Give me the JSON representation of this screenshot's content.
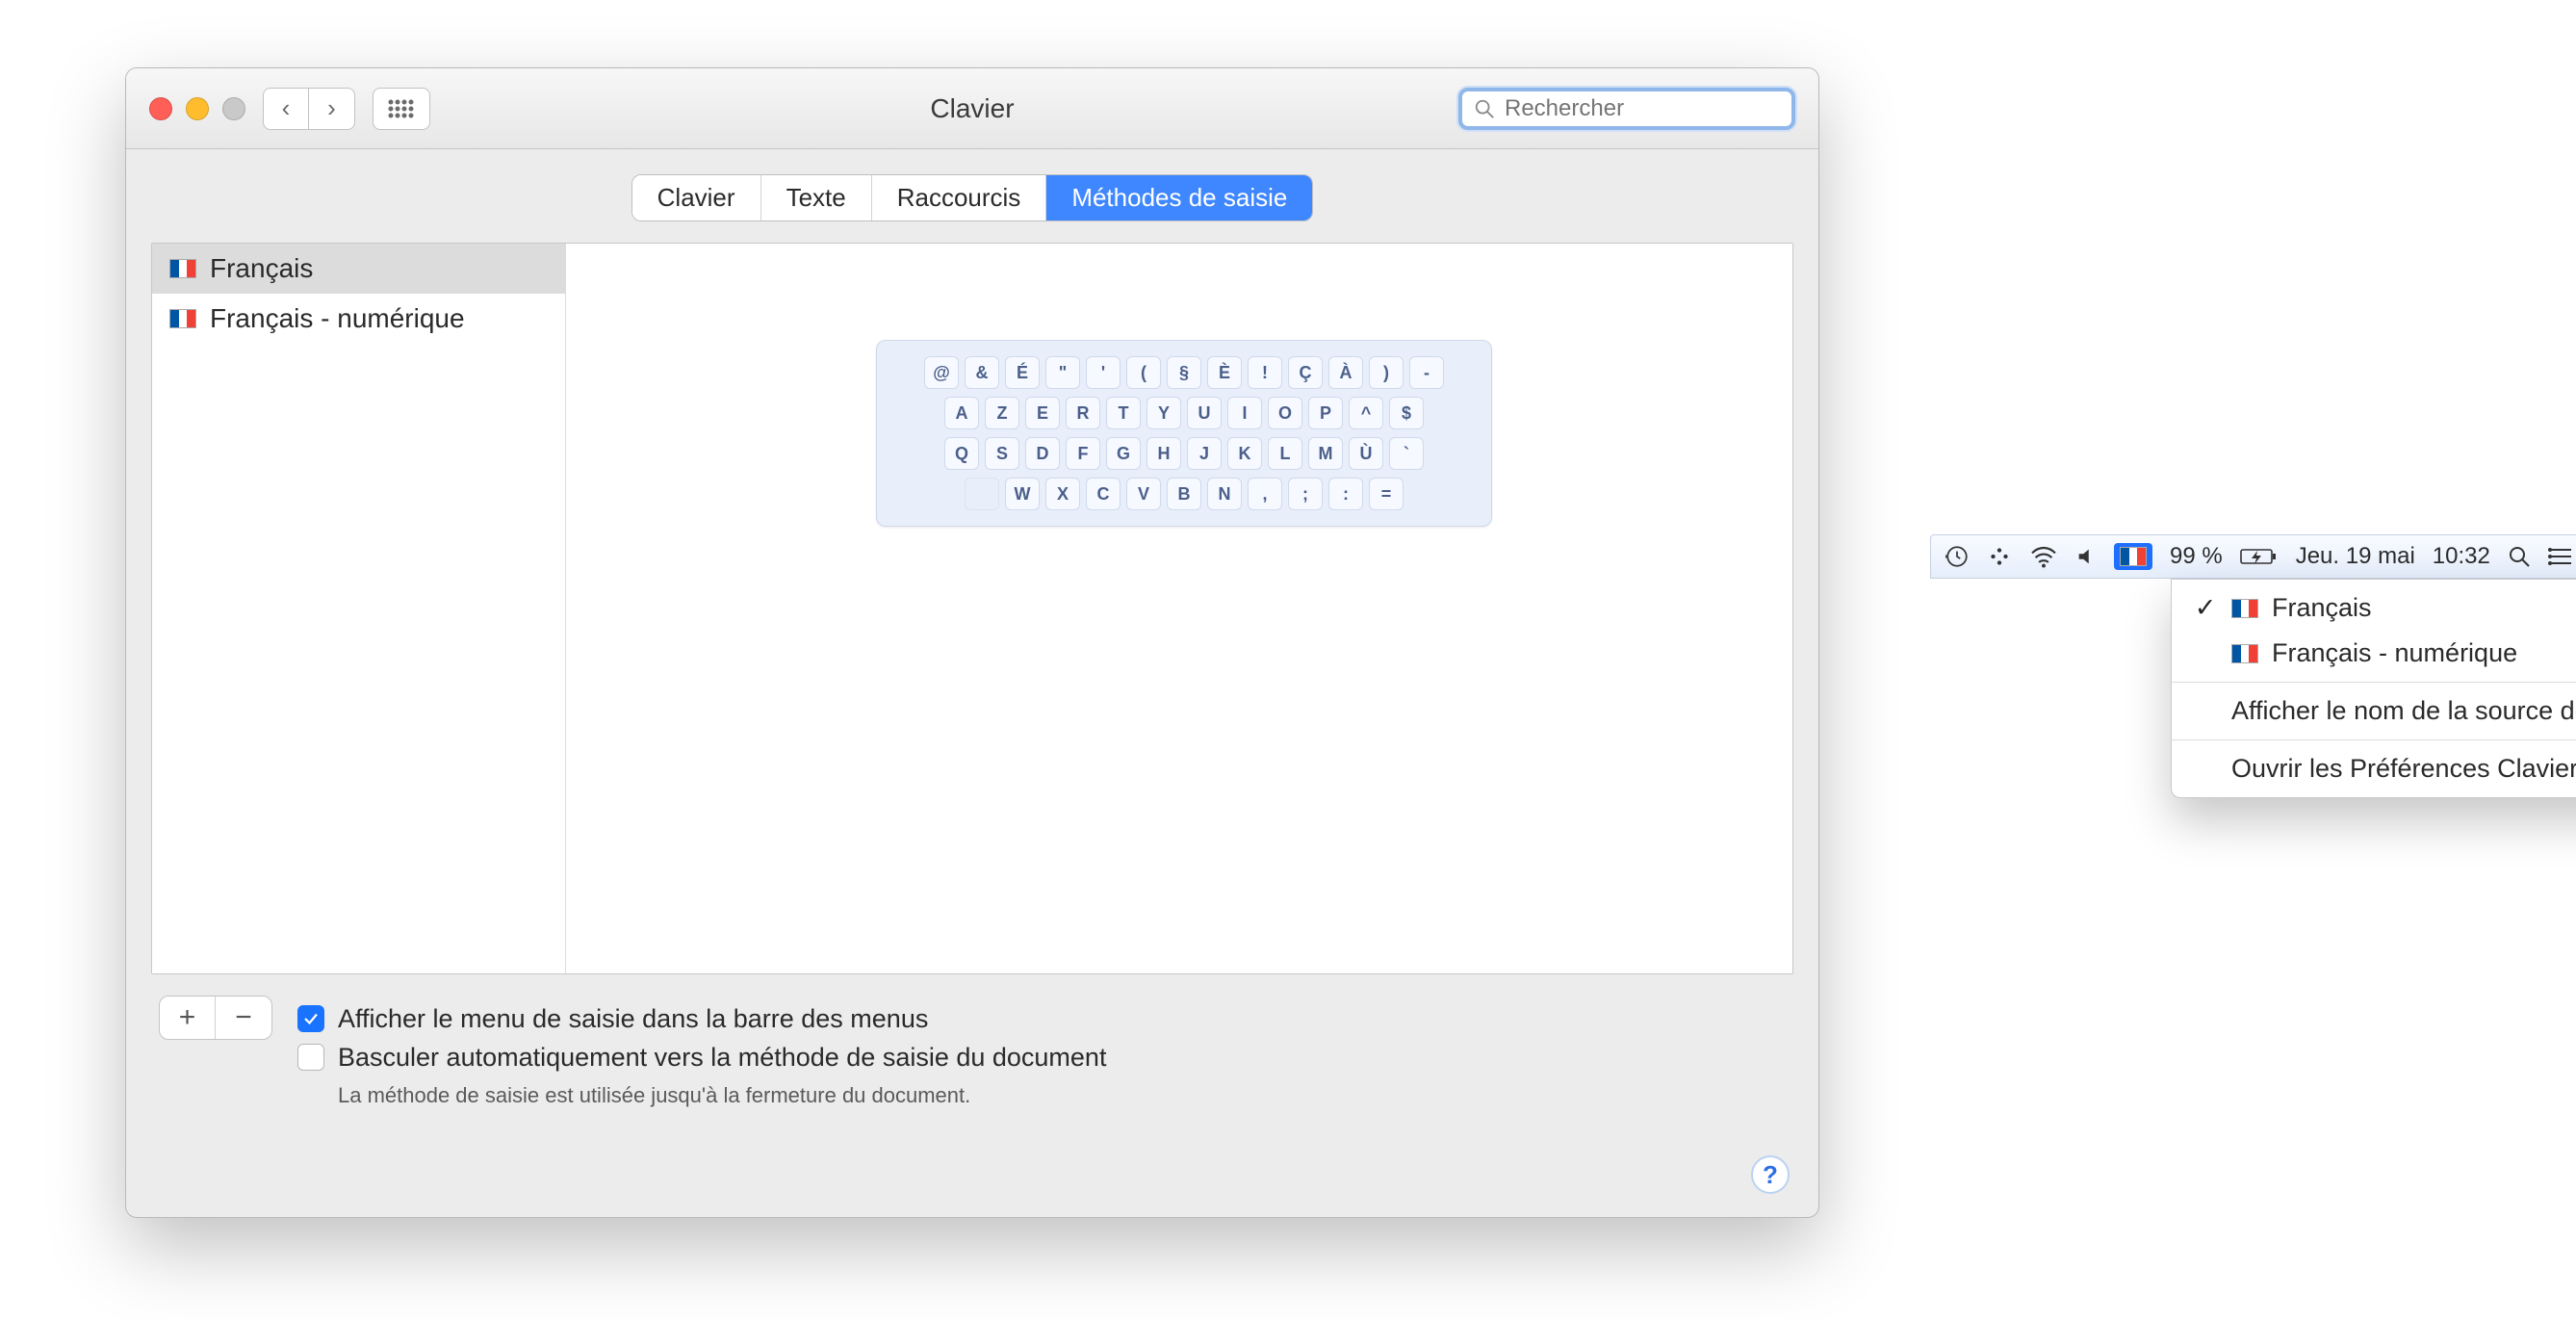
{
  "window": {
    "title": "Clavier",
    "search_placeholder": "Rechercher"
  },
  "tabs": [
    {
      "label": "Clavier",
      "active": false
    },
    {
      "label": "Texte",
      "active": false
    },
    {
      "label": "Raccourcis",
      "active": false
    },
    {
      "label": "Méthodes de saisie",
      "active": true
    }
  ],
  "input_sources": [
    {
      "label": "Français",
      "selected": true,
      "numeric_flag": false
    },
    {
      "label": "Français - numérique",
      "selected": false,
      "numeric_flag": true
    }
  ],
  "keyboard_rows": [
    [
      "@",
      "&",
      "É",
      "\"",
      "'",
      "(",
      "§",
      "È",
      "!",
      "Ç",
      "À",
      ")",
      "-"
    ],
    [
      "A",
      "Z",
      "E",
      "R",
      "T",
      "Y",
      "U",
      "I",
      "O",
      "P",
      "^",
      "$"
    ],
    [
      "Q",
      "S",
      "D",
      "F",
      "G",
      "H",
      "J",
      "K",
      "L",
      "M",
      "Ù",
      "`"
    ],
    [
      "",
      "W",
      "X",
      "C",
      "V",
      "B",
      "N",
      ",",
      ";",
      ":",
      "="
    ]
  ],
  "options": {
    "show_menu": {
      "label": "Afficher le menu de saisie dans la barre des menus",
      "checked": true
    },
    "auto_switch": {
      "label": "Basculer automatiquement vers la méthode de saisie du document",
      "checked": false,
      "sub": "La méthode de saisie est utilisée jusqu'à la fermeture du document."
    }
  },
  "menubar": {
    "battery_percent": "99 %",
    "date": "Jeu. 19 mai",
    "time": "10:32"
  },
  "dropdown": {
    "items": [
      {
        "label": "Français",
        "checked": true,
        "numeric_flag": false
      },
      {
        "label": "Français - numérique",
        "checked": false,
        "numeric_flag": true
      }
    ],
    "actions": [
      "Afficher le nom de la source de saisie",
      "Ouvrir les Préférences Clavier…"
    ]
  }
}
